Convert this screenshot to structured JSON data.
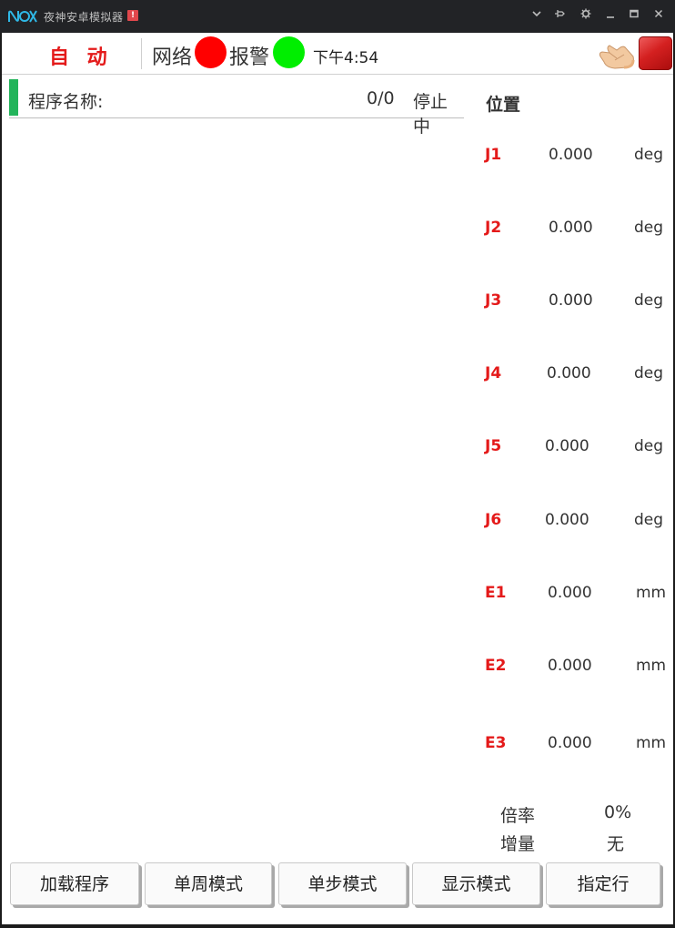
{
  "window": {
    "title": "夜神安卓模拟器",
    "warn_badge": "!",
    "controls": [
      "chevron-down-icon",
      "pin-icon",
      "gear-icon",
      "minimize-icon",
      "maximize-icon",
      "close-icon"
    ]
  },
  "header": {
    "mode": "自 动",
    "network_label": "网络",
    "network_status_color": "#ff0000",
    "alarm_label": "报警",
    "alarm_status_color": "#00ee00",
    "time": "下午4:54"
  },
  "program": {
    "name_label": "程序名称:",
    "line_count": "0/0",
    "status": "停止中",
    "marker_color": "#22b45a"
  },
  "position": {
    "title": "位置",
    "axes": [
      {
        "name": "J1",
        "value": "0.000",
        "unit": "deg"
      },
      {
        "name": "J2",
        "value": "0.000",
        "unit": "deg"
      },
      {
        "name": "J3",
        "value": "0.000",
        "unit": "deg"
      },
      {
        "name": "J4",
        "value": "0.000",
        "unit": "deg"
      },
      {
        "name": "J5",
        "value": "0.000",
        "unit": "deg"
      },
      {
        "name": "J6",
        "value": "0.000",
        "unit": "deg"
      },
      {
        "name": "E1",
        "value": "0.000",
        "unit": "mm"
      },
      {
        "name": "E2",
        "value": "0.000",
        "unit": "mm"
      },
      {
        "name": "E3",
        "value": "0.000",
        "unit": "mm"
      }
    ]
  },
  "override": {
    "rate_label": "倍率",
    "rate_value": "0%",
    "increment_label": "增量",
    "increment_value": "无"
  },
  "buttons": {
    "load_program": "加载程序",
    "cycle_mode": "单周模式",
    "step_mode": "单步模式",
    "display_mode": "显示模式",
    "goto_line": "指定行"
  },
  "colors": {
    "axis_label": "#e41a1a",
    "mode_label": "#e41a1a",
    "estop": "#d42020"
  }
}
